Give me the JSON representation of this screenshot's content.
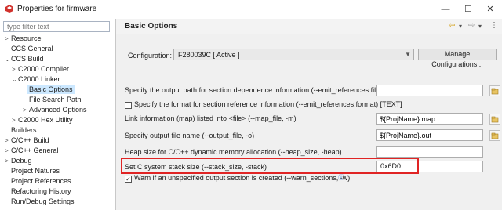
{
  "window": {
    "title": "Properties for firmware",
    "minimize": "—",
    "maximize": "☐",
    "close": "✕"
  },
  "filter": {
    "placeholder": "type filter text"
  },
  "tree": [
    {
      "label": "Resource",
      "twisty": ">"
    },
    {
      "label": "CCS General",
      "twisty": ""
    },
    {
      "label": "CCS Build",
      "twisty": "⌄"
    },
    {
      "label": "C2000 Compiler",
      "twisty": ">"
    },
    {
      "label": "C2000 Linker",
      "twisty": "⌄"
    },
    {
      "label": "Basic Options",
      "twisty": ""
    },
    {
      "label": "File Search Path",
      "twisty": ""
    },
    {
      "label": "Advanced Options",
      "twisty": ">"
    },
    {
      "label": "C2000 Hex Utility",
      "twisty": ">"
    },
    {
      "label": "Builders",
      "twisty": ""
    },
    {
      "label": "C/C++ Build",
      "twisty": ">"
    },
    {
      "label": "C/C++ General",
      "twisty": ">"
    },
    {
      "label": "Debug",
      "twisty": ">"
    },
    {
      "label": "Project Natures",
      "twisty": ""
    },
    {
      "label": "Project References",
      "twisty": ""
    },
    {
      "label": "Refactoring History",
      "twisty": ""
    },
    {
      "label": "Run/Debug Settings",
      "twisty": ""
    }
  ],
  "header": {
    "title": "Basic Options",
    "nav_icons": [
      "⇦",
      "▾",
      "⇨",
      "▾",
      "⋮"
    ]
  },
  "configuration": {
    "label": "Configuration:",
    "value": "F280039C  [ Active ]",
    "manage_button": "Manage Configurations..."
  },
  "options": {
    "emit_references": {
      "label": "Specify the output path for section dependence information (--emit_references:file)",
      "value": ""
    },
    "emit_references_format": {
      "label": "Specify the format for section reference information (--emit_references:format) [TEXT]",
      "checked": false
    },
    "map_file": {
      "label": "Link information (map) listed into <file> (--map_file, -m)",
      "value": "${ProjName}.map"
    },
    "output_file": {
      "label": "Specify output file name (--output_file, -o)",
      "value": "${ProjName}.out"
    },
    "heap_size": {
      "label": "Heap size for C/C++ dynamic memory allocation (--heap_size, -heap)",
      "value": ""
    },
    "stack_size": {
      "label": "Set C system stack size (--stack_size, -stack)",
      "value": "0x6D0"
    },
    "warn_sections": {
      "label": "Warn if an unspecified output section is created (--warn_sections, -w)",
      "checked": true
    }
  },
  "colors": {
    "highlight_border": "#e02424",
    "selected_bg": "#cce8ff",
    "app_icon": "#d1312c"
  }
}
